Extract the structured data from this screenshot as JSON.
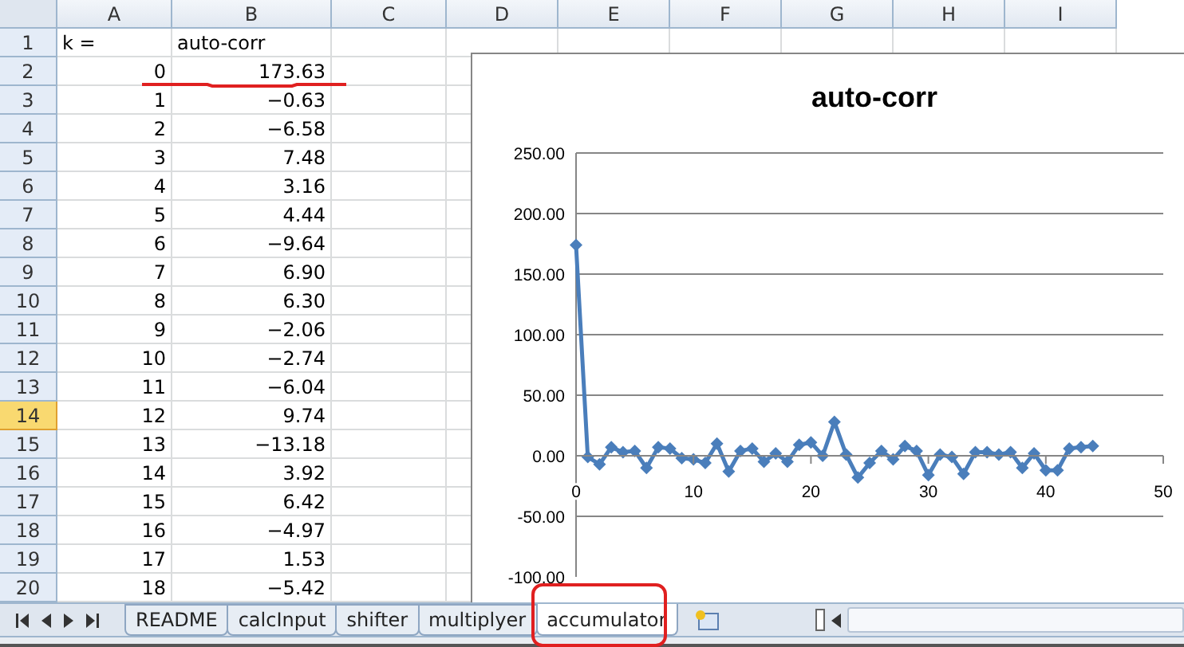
{
  "columns": [
    "A",
    "B",
    "C",
    "D",
    "E",
    "F",
    "G",
    "H",
    "I"
  ],
  "rows": [
    {
      "number": "1",
      "selected": false,
      "cells": [
        {
          "text": "k =",
          "kind": "text"
        },
        {
          "text": "auto-corr",
          "kind": "text"
        }
      ]
    },
    {
      "number": "2",
      "selected": false,
      "cells": [
        {
          "text": "0",
          "kind": "number"
        },
        {
          "text": "173.63",
          "kind": "number"
        }
      ]
    },
    {
      "number": "3",
      "selected": false,
      "cells": [
        {
          "text": "1",
          "kind": "number"
        },
        {
          "text": "−0.63",
          "kind": "number"
        }
      ]
    },
    {
      "number": "4",
      "selected": false,
      "cells": [
        {
          "text": "2",
          "kind": "number"
        },
        {
          "text": "−6.58",
          "kind": "number"
        }
      ]
    },
    {
      "number": "5",
      "selected": false,
      "cells": [
        {
          "text": "3",
          "kind": "number"
        },
        {
          "text": "7.48",
          "kind": "number"
        }
      ]
    },
    {
      "number": "6",
      "selected": false,
      "cells": [
        {
          "text": "4",
          "kind": "number"
        },
        {
          "text": "3.16",
          "kind": "number"
        }
      ]
    },
    {
      "number": "7",
      "selected": false,
      "cells": [
        {
          "text": "5",
          "kind": "number"
        },
        {
          "text": "4.44",
          "kind": "number"
        }
      ]
    },
    {
      "number": "8",
      "selected": false,
      "cells": [
        {
          "text": "6",
          "kind": "number"
        },
        {
          "text": "−9.64",
          "kind": "number"
        }
      ]
    },
    {
      "number": "9",
      "selected": false,
      "cells": [
        {
          "text": "7",
          "kind": "number"
        },
        {
          "text": "6.90",
          "kind": "number"
        }
      ]
    },
    {
      "number": "10",
      "selected": false,
      "cells": [
        {
          "text": "8",
          "kind": "number"
        },
        {
          "text": "6.30",
          "kind": "number"
        }
      ]
    },
    {
      "number": "11",
      "selected": false,
      "cells": [
        {
          "text": "9",
          "kind": "number"
        },
        {
          "text": "−2.06",
          "kind": "number"
        }
      ]
    },
    {
      "number": "12",
      "selected": false,
      "cells": [
        {
          "text": "10",
          "kind": "number"
        },
        {
          "text": "−2.74",
          "kind": "number"
        }
      ]
    },
    {
      "number": "13",
      "selected": false,
      "cells": [
        {
          "text": "11",
          "kind": "number"
        },
        {
          "text": "−6.04",
          "kind": "number"
        }
      ]
    },
    {
      "number": "14",
      "selected": true,
      "cells": [
        {
          "text": "12",
          "kind": "number"
        },
        {
          "text": "9.74",
          "kind": "number"
        }
      ]
    },
    {
      "number": "15",
      "selected": false,
      "cells": [
        {
          "text": "13",
          "kind": "number"
        },
        {
          "text": "−13.18",
          "kind": "number"
        }
      ]
    },
    {
      "number": "16",
      "selected": false,
      "cells": [
        {
          "text": "14",
          "kind": "number"
        },
        {
          "text": "3.92",
          "kind": "number"
        }
      ]
    },
    {
      "number": "17",
      "selected": false,
      "cells": [
        {
          "text": "15",
          "kind": "number"
        },
        {
          "text": "6.42",
          "kind": "number"
        }
      ]
    },
    {
      "number": "18",
      "selected": false,
      "cells": [
        {
          "text": "16",
          "kind": "number"
        },
        {
          "text": "−4.97",
          "kind": "number"
        }
      ]
    },
    {
      "number": "19",
      "selected": false,
      "cells": [
        {
          "text": "17",
          "kind": "number"
        },
        {
          "text": "1.53",
          "kind": "number"
        }
      ]
    },
    {
      "number": "20",
      "selected": false,
      "cells": [
        {
          "text": "18",
          "kind": "number"
        },
        {
          "text": "−5.42",
          "kind": "number"
        }
      ]
    }
  ],
  "chart": {
    "chart_data": {
      "type": "line",
      "title": "auto-corr",
      "grid": true,
      "x": [
        0,
        1,
        2,
        3,
        4,
        5,
        6,
        7,
        8,
        9,
        10,
        11,
        12,
        13,
        14,
        15,
        16,
        17,
        18,
        19,
        20,
        21,
        22,
        23,
        24,
        25,
        26,
        27,
        28,
        29,
        30,
        31,
        32,
        33,
        34,
        35,
        36,
        37,
        38,
        39,
        40,
        41,
        42,
        43,
        44
      ],
      "series": [
        {
          "color": "#4a7ebb",
          "marker": "diamond",
          "values": [
            174,
            -1,
            -7,
            7,
            3,
            4,
            -10,
            7,
            6,
            -2,
            -3,
            -6,
            10,
            -13,
            4,
            6,
            -5,
            2,
            -5,
            9,
            11,
            0,
            28,
            1,
            -18,
            -6,
            4,
            -3,
            8,
            4,
            -16,
            1,
            -1,
            -15,
            3,
            3,
            1,
            3,
            -10,
            2,
            -12,
            -12,
            6,
            7,
            8
          ]
        }
      ],
      "xlim": [
        0,
        50
      ],
      "ylim": [
        -100,
        250
      ],
      "xticks": [
        0,
        10,
        20,
        30,
        40,
        50
      ],
      "yticks": [
        {
          "value": 250,
          "label": "250.00"
        },
        {
          "value": 200,
          "label": "200.00"
        },
        {
          "value": 150,
          "label": "150.00"
        },
        {
          "value": 100,
          "label": "100.00"
        },
        {
          "value": 50,
          "label": "50.00"
        },
        {
          "value": 0,
          "label": "0.00"
        },
        {
          "value": -50,
          "label": "-50.00"
        },
        {
          "value": -100,
          "label": "-100.00"
        }
      ]
    }
  },
  "sheet_tabs": [
    {
      "label": "README",
      "selected": false
    },
    {
      "label": "calcInput",
      "selected": false
    },
    {
      "label": "shifter",
      "selected": false
    },
    {
      "label": "multiplyer",
      "selected": false
    },
    {
      "label": "accumulator",
      "selected": true
    }
  ]
}
